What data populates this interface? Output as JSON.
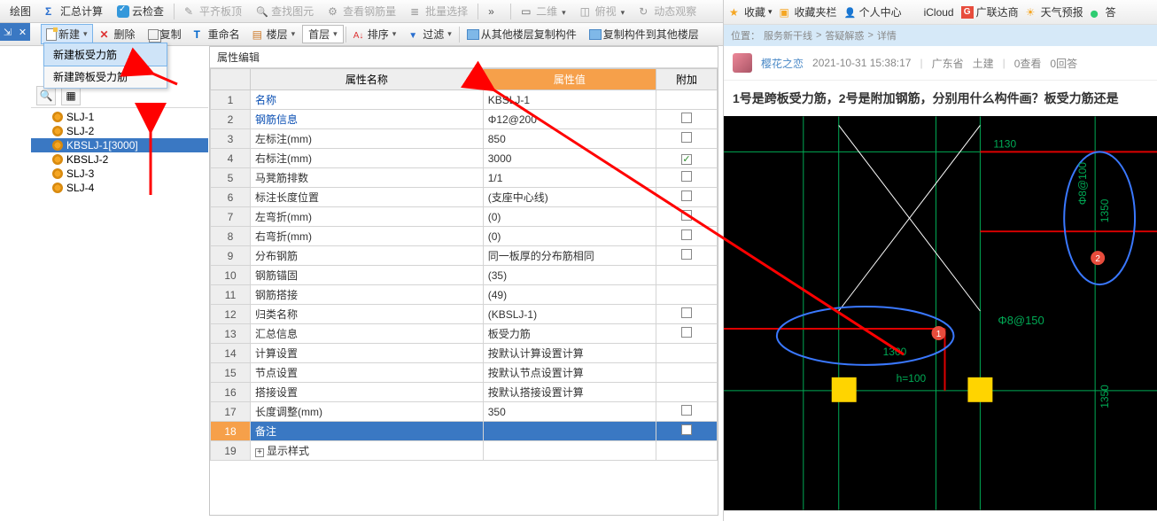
{
  "topbar": {
    "draw": "绘图",
    "sum": "汇总计算",
    "cloud": "云检查",
    "flat": "平齐板顶",
    "findpic": "查找图元",
    "rebarqty": "查看钢筋量",
    "batch": "批量选择",
    "twod": "二维",
    "bird": "俯视",
    "dynamic": "动态观察"
  },
  "toolbar2": {
    "new": "新建",
    "delete": "删除",
    "copy": "复制",
    "rename": "重命名",
    "floor": "楼层",
    "first_floor": "首层",
    "sort": "排序",
    "filter": "过滤",
    "copy_from": "从其他楼层复制构件",
    "copy_to": "复制构件到其他楼层"
  },
  "dropdown": {
    "opt1": "新建板受力筋",
    "opt2": "新建跨板受力筋"
  },
  "tree": {
    "items": [
      {
        "label": "SLJ-1"
      },
      {
        "label": "SLJ-2"
      },
      {
        "label": "KBSLJ-1[3000]"
      },
      {
        "label": "KBSLJ-2"
      },
      {
        "label": "SLJ-3"
      },
      {
        "label": "SLJ-4"
      }
    ]
  },
  "prop": {
    "title": "属性编辑",
    "col_name": "属性名称",
    "col_value": "属性值",
    "col_extra": "附加",
    "rows": [
      {
        "n": "1",
        "name": "名称",
        "val": "KBSLJ-1",
        "chk": ""
      },
      {
        "n": "2",
        "name": "钢筋信息",
        "val": "Φ12@200",
        "chk": "off"
      },
      {
        "n": "3",
        "name": "左标注(mm)",
        "val": "850",
        "chk": "off",
        "black": true
      },
      {
        "n": "4",
        "name": "右标注(mm)",
        "val": "3000",
        "chk": "on",
        "black": true
      },
      {
        "n": "5",
        "name": "马凳筋排数",
        "val": "1/1",
        "chk": "off",
        "black": true
      },
      {
        "n": "6",
        "name": "标注长度位置",
        "val": "(支座中心线)",
        "chk": "off",
        "black": true
      },
      {
        "n": "7",
        "name": "左弯折(mm)",
        "val": "(0)",
        "chk": "off",
        "black": true
      },
      {
        "n": "8",
        "name": "右弯折(mm)",
        "val": "(0)",
        "chk": "off",
        "black": true
      },
      {
        "n": "9",
        "name": "分布钢筋",
        "val": "同一板厚的分布筋相同",
        "chk": "off",
        "black": true
      },
      {
        "n": "10",
        "name": "钢筋锚固",
        "val": "(35)",
        "chk": "",
        "black": true
      },
      {
        "n": "11",
        "name": "钢筋搭接",
        "val": "(49)",
        "chk": "",
        "black": true
      },
      {
        "n": "12",
        "name": "归类名称",
        "val": "(KBSLJ-1)",
        "chk": "off",
        "black": true
      },
      {
        "n": "13",
        "name": "汇总信息",
        "val": "板受力筋",
        "chk": "off",
        "black": true
      },
      {
        "n": "14",
        "name": "计算设置",
        "val": "按默认计算设置计算",
        "chk": "",
        "black": true
      },
      {
        "n": "15",
        "name": "节点设置",
        "val": "按默认节点设置计算",
        "chk": "",
        "black": true
      },
      {
        "n": "16",
        "name": "搭接设置",
        "val": "按默认搭接设置计算",
        "chk": "",
        "black": true
      },
      {
        "n": "17",
        "name": "长度调整(mm)",
        "val": "350",
        "chk": "off",
        "black": true
      },
      {
        "n": "18",
        "name": "备注",
        "val": "",
        "chk": "off",
        "sel": true
      },
      {
        "n": "19",
        "name": "显示样式",
        "val": "",
        "chk": "",
        "expand": true,
        "black": true
      }
    ]
  },
  "right": {
    "bookmarks": {
      "fav": "收藏",
      "folder": "收藏夹栏",
      "personal": "个人中心",
      "icloud": "iCloud",
      "glodon": "广联达商",
      "weather": "天气预报",
      "answer": "答"
    },
    "breadcrumb": {
      "a": "位置：",
      "b": "服务新干线",
      "c": "答疑解惑",
      "d": "详情"
    },
    "post": {
      "user": "樱花之恋",
      "time": "2021-10-31 15:38:17",
      "region": "广东省",
      "category": "土建",
      "views": "0查看",
      "replies": "0回答",
      "title": "1号是跨板受力筋，2号是附加钢筋，分别用什么构件画？板受力筋还是"
    },
    "cad": {
      "t1": "1130",
      "t2": "Φ8@100",
      "t3": "1350",
      "t4": "Φ8@150",
      "t5": "1300",
      "t6": "h=100",
      "t7": "1350"
    }
  }
}
